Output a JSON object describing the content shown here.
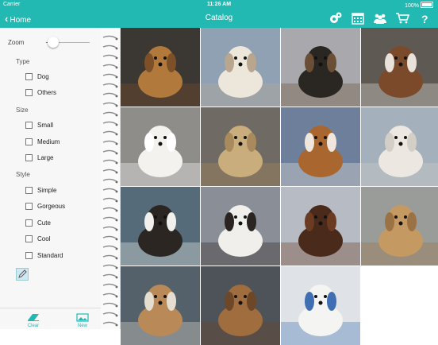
{
  "status": {
    "carrier": "Carrier",
    "time": "11:26 AM",
    "battery": "100%"
  },
  "nav": {
    "back_label": "Home",
    "title": "Catalog",
    "icons": [
      "settings-gears-icon",
      "calendar-icon",
      "customers-icon",
      "cart-icon",
      "help-icon"
    ]
  },
  "filters": {
    "zoom_label": "Zoom",
    "zoom_level": 0.17,
    "groups": [
      {
        "title": "Type",
        "options": [
          "Dog",
          "Others"
        ]
      },
      {
        "title": "Size",
        "options": [
          "Small",
          "Medium",
          "Large"
        ]
      },
      {
        "title": "Style",
        "options": [
          "Simple",
          "Gorgeous",
          "Cute",
          "Cool",
          "Standard"
        ]
      }
    ]
  },
  "toolbar": {
    "clear_label": "Clear",
    "new_label": "New"
  },
  "catalog": [
    {
      "bg": "#3b3733",
      "fg": "#b17a3c",
      "accent": "#7d5027"
    },
    {
      "bg": "#8fa1b3",
      "fg": "#ede7db",
      "accent": "#b8a68e"
    },
    {
      "bg": "#a8a8ad",
      "fg": "#2a2622",
      "accent": "#6a4f36"
    },
    {
      "bg": "#5e5a53",
      "fg": "#7b4a2a",
      "accent": "#e8e2da"
    },
    {
      "bg": "#8f8d8a",
      "fg": "#f4f2ef",
      "accent": "#ffffff"
    },
    {
      "bg": "#6f6a63",
      "fg": "#c9ad7c",
      "accent": "#a98a5c"
    },
    {
      "bg": "#6d7f9a",
      "fg": "#a9672f",
      "accent": "#efe7dd"
    },
    {
      "bg": "#a4b1bd",
      "fg": "#ece8e1",
      "accent": "#d3cec6"
    },
    {
      "bg": "#556b7a",
      "fg": "#2b2622",
      "accent": "#f2f0ec"
    },
    {
      "bg": "#8a8e97",
      "fg": "#f1efeb",
      "accent": "#2a2522"
    },
    {
      "bg": "#b7bbc4",
      "fg": "#4a2a1a",
      "accent": "#6b3c22"
    },
    {
      "bg": "#9a9c9a",
      "fg": "#c49a62",
      "accent": "#9a7244"
    },
    {
      "bg": "#54606a",
      "fg": "#b98a58",
      "accent": "#e5ddd0"
    },
    {
      "bg": "#4d5358",
      "fg": "#a06d3e",
      "accent": "#6e4628"
    },
    {
      "bg": "#dfe3e8",
      "fg": "#f4f4f2",
      "accent": "#3f6fb2"
    }
  ]
}
